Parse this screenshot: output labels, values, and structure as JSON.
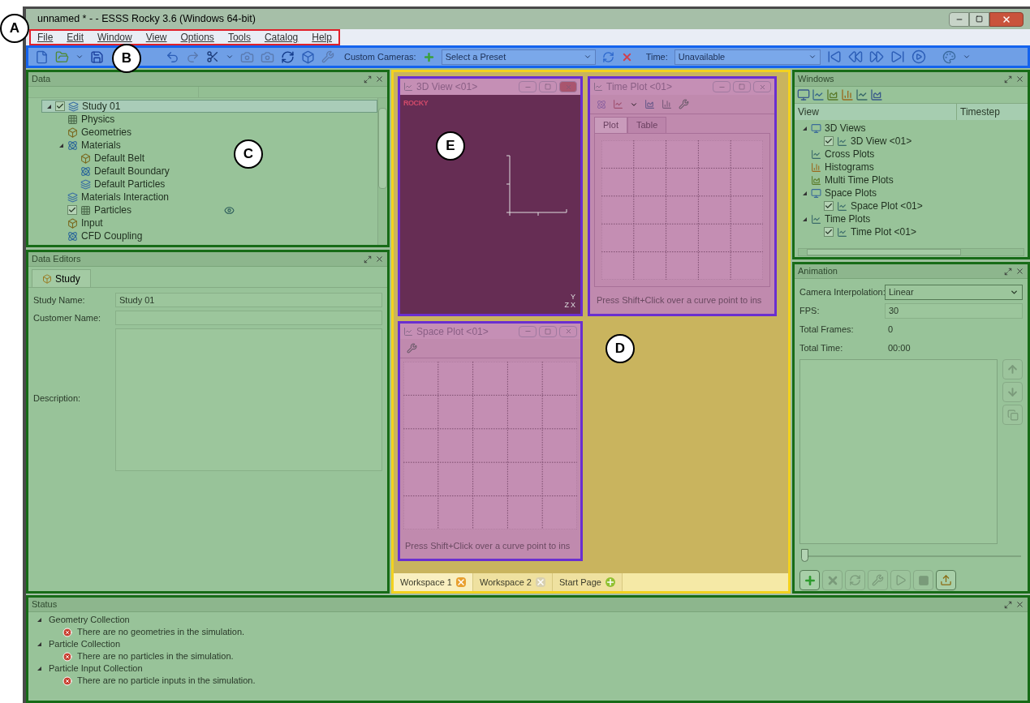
{
  "window": {
    "title": "unnamed * - - ESSS Rocky 3.6 (Windows 64-bit)"
  },
  "menu": [
    "File",
    "Edit",
    "Window",
    "View",
    "Options",
    "Tools",
    "Catalog",
    "Help"
  ],
  "toolbar": {
    "cameras_label": "Custom Cameras:",
    "preset": "Select a Preset",
    "time_label": "Time:",
    "time": "Unavailable"
  },
  "data_panel": {
    "title": "Data",
    "tree": [
      {
        "label": "Study 01",
        "expanded": true,
        "checked": true,
        "selected": true,
        "children": [
          {
            "label": "Physics"
          },
          {
            "label": "Geometries"
          },
          {
            "label": "Materials",
            "expanded": true,
            "children": [
              {
                "label": "Default Belt"
              },
              {
                "label": "Default Boundary"
              },
              {
                "label": "Default Particles"
              }
            ]
          },
          {
            "label": "Materials Interaction"
          },
          {
            "label": "Particles",
            "checked": true,
            "visible": true
          },
          {
            "label": "Input"
          },
          {
            "label": "CFD Coupling"
          }
        ]
      }
    ]
  },
  "editors_panel": {
    "title": "Data Editors",
    "tab": {
      "label": "Study",
      "selected": true
    },
    "fields": [
      {
        "label": "Study Name:",
        "value": "Study 01",
        "kind": "line"
      },
      {
        "label": "Customer Name:",
        "kind": "line"
      },
      {
        "label": "Description:",
        "kind": "area"
      }
    ]
  },
  "workspace": {
    "view3d": {
      "title": "3D View <01>",
      "logo": "ROCKY",
      "axes": [
        "Y",
        "Z",
        "X"
      ]
    },
    "time_plot": {
      "title": "Time Plot <01>",
      "tabs": [
        {
          "label": "Plot",
          "selected": true
        },
        {
          "label": "Table",
          "selected": false
        }
      ],
      "hint": "Press Shift+Click over a curve point to ins"
    },
    "space_plot": {
      "title": "Space Plot <01>",
      "hint": "Press Shift+Click over a curve point to ins"
    },
    "tabs": [
      {
        "label": "Workspace 1",
        "selected": true,
        "kind": "close"
      },
      {
        "label": "Workspace 2",
        "selected": false,
        "kind": "close"
      },
      {
        "label": "Start Page",
        "selected": false,
        "kind": "add"
      }
    ]
  },
  "windows_panel": {
    "title": "Windows",
    "columns": [
      "View",
      "Timestep"
    ],
    "tree": [
      {
        "label": "3D Views",
        "expanded": true,
        "children": [
          {
            "label": "3D View <01>",
            "checked": true
          }
        ]
      },
      {
        "label": "Cross Plots"
      },
      {
        "label": "Histograms"
      },
      {
        "label": "Multi Time Plots"
      },
      {
        "label": "Space Plots",
        "expanded": true,
        "children": [
          {
            "label": "Space Plot <01>",
            "checked": true
          }
        ]
      },
      {
        "label": "Time Plots",
        "expanded": true,
        "children": [
          {
            "label": "Time Plot <01>",
            "checked": true
          }
        ]
      }
    ]
  },
  "animation_panel": {
    "title": "Animation",
    "rows": [
      {
        "label": "Camera Interpolation:",
        "value": "Linear",
        "kind": "select"
      },
      {
        "label": "FPS:",
        "value": "30",
        "kind": "input"
      },
      {
        "label": "Total Frames:",
        "value": "0",
        "kind": "text"
      },
      {
        "label": "Total Time:",
        "value": "00:00",
        "kind": "text"
      }
    ],
    "slider": {
      "level": 0
    },
    "side_buttons": [
      {
        "kind": "up",
        "disabled": true
      },
      {
        "kind": "down",
        "disabled": true
      },
      {
        "kind": "copy",
        "disabled": true
      }
    ],
    "buttons": [
      {
        "kind": "add",
        "disabled": false
      },
      {
        "kind": "remove",
        "disabled": true
      },
      {
        "kind": "refresh",
        "disabled": true
      },
      {
        "kind": "tools",
        "disabled": true
      },
      {
        "kind": "play",
        "disabled": true
      },
      {
        "kind": "stop",
        "disabled": true
      },
      {
        "kind": "export",
        "disabled": false
      }
    ]
  },
  "status_panel": {
    "title": "Status",
    "groups": [
      {
        "label": "Geometry Collection",
        "expanded": true,
        "messages": [
          "There are no geometries in the simulation."
        ]
      },
      {
        "label": "Particle Collection",
        "expanded": true,
        "messages": [
          "There are no particles in the simulation."
        ]
      },
      {
        "label": "Particle Input Collection",
        "expanded": true,
        "messages": [
          "There are no particle inputs in the simulation."
        ]
      }
    ]
  },
  "callouts": [
    "A",
    "B",
    "C",
    "D",
    "E"
  ]
}
